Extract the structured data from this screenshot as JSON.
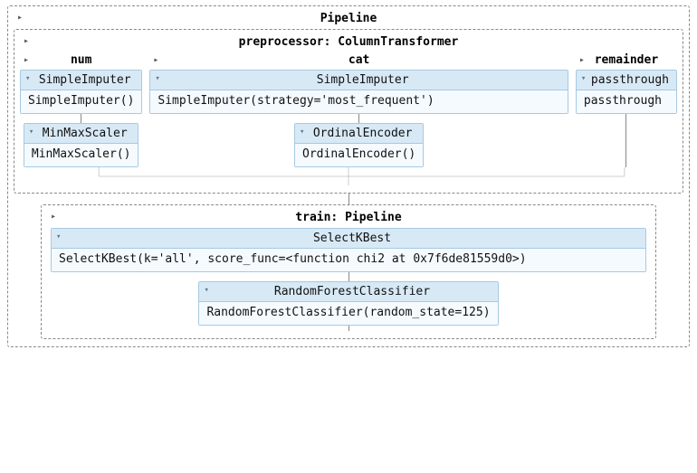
{
  "pipeline": {
    "title": "Pipeline",
    "preprocessor": {
      "title": "preprocessor: ColumnTransformer",
      "columns": {
        "num": {
          "title": "num",
          "steps": [
            {
              "name": "SimpleImputer",
              "repr": "SimpleImputer()"
            },
            {
              "name": "MinMaxScaler",
              "repr": "MinMaxScaler()"
            }
          ]
        },
        "cat": {
          "title": "cat",
          "steps": [
            {
              "name": "SimpleImputer",
              "repr": "SimpleImputer(strategy='most_frequent')"
            },
            {
              "name": "OrdinalEncoder",
              "repr": "OrdinalEncoder()"
            }
          ]
        },
        "remainder": {
          "title": "remainder",
          "step": {
            "name": "passthrough",
            "repr": "passthrough"
          }
        }
      }
    },
    "train": {
      "title": "train: Pipeline",
      "steps": [
        {
          "name": "SelectKBest",
          "repr": "SelectKBest(k='all', score_func=<function chi2 at 0x7f6de81559d0>)"
        },
        {
          "name": "RandomForestClassifier",
          "repr": "RandomForestClassifier(random_state=125)"
        }
      ]
    }
  },
  "colors": {
    "box_border": "#a6c9e2",
    "box_header_bg": "#d8e9f6",
    "box_body_bg": "#f5faff",
    "dashed_border": "#888888"
  }
}
